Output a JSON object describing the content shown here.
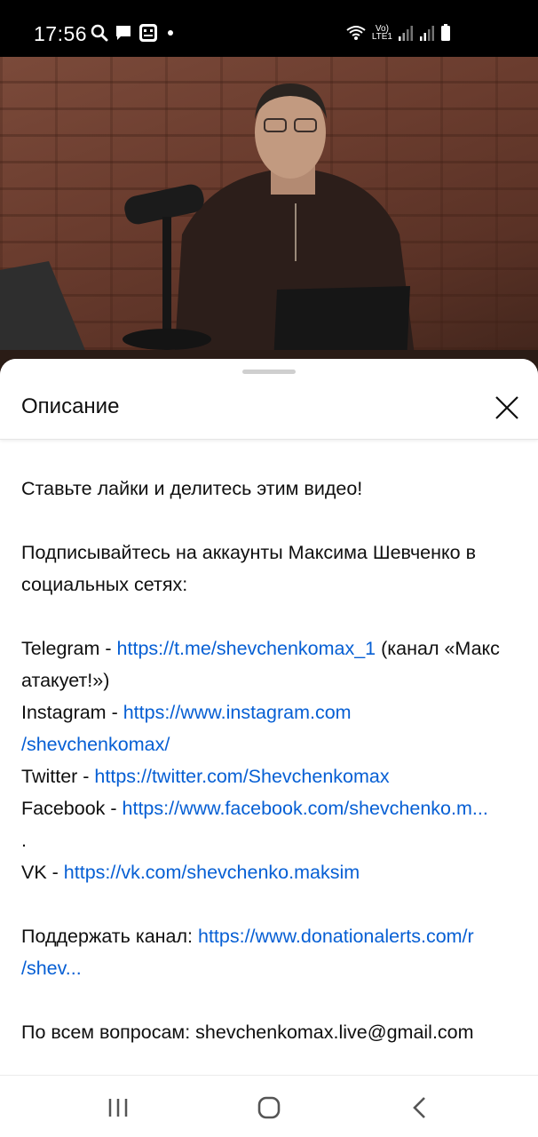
{
  "status_bar": {
    "time": "17:56",
    "icons_left": [
      "search-icon",
      "chat-icon",
      "app-notification-icon",
      "dot-icon"
    ],
    "lte_label_top": "Vo)",
    "lte_label_bottom": "LTE1",
    "icons_right": [
      "wifi-icon",
      "signal-icon",
      "signal-icon",
      "battery-icon"
    ]
  },
  "sheet": {
    "title": "Описание"
  },
  "description": {
    "line1": "Ставьте лайки и делитесь этим видео!",
    "line2": "Подписывайтесь на аккаунты Максима Шевченко в социальных сетях:",
    "telegram_label": "Telegram - ",
    "telegram_url": "https://t.me/shevchenkomax_1",
    "telegram_suffix": " (канал «Макс атакует!»)",
    "instagram_label": "Instagram - ",
    "instagram_url_a": "https://www.instagram.com",
    "instagram_url_b": "/shevchenkomax/",
    "twitter_label": "Twitter - ",
    "twitter_url": "https://twitter.com/Shevchenkomax",
    "facebook_label": "Facebook - ",
    "facebook_url": "https://www.facebook.com/shevchenko.m...",
    "facebook_tail": ".",
    "vk_label": "VK - ",
    "vk_url": "https://vk.com/shevchenko.maksim",
    "support_label": "Поддержать канал: ",
    "support_url_a": "https://www.donationalerts.com/r",
    "support_url_b": "/shev...",
    "contact_text": "По всем вопросам: shevchenkomax.live@gmail.com"
  },
  "nav_bar": {
    "buttons": [
      "recent-apps-icon",
      "home-icon",
      "back-icon"
    ]
  },
  "colors": {
    "link": "#065fd4",
    "text": "#0f0f0f",
    "status_bar_bg": "#000000"
  }
}
